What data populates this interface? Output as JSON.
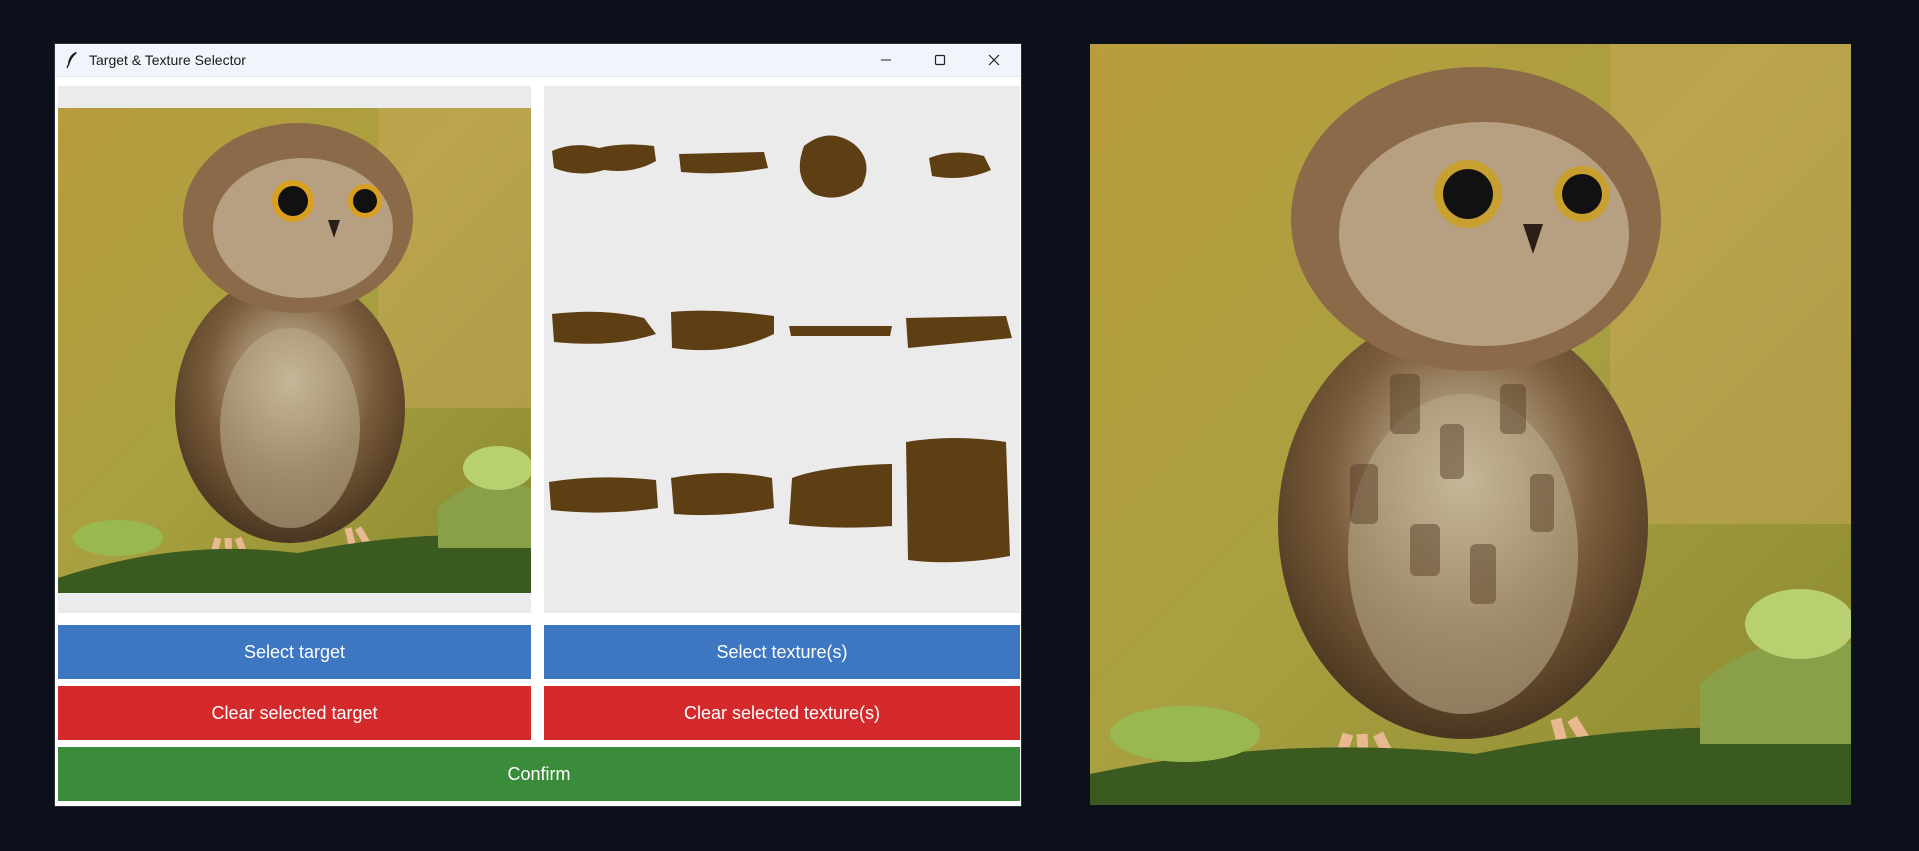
{
  "window": {
    "title": "Target & Texture Selector",
    "icon": "feather-icon",
    "controls": [
      "minimize-icon",
      "maximize-icon",
      "close-icon"
    ]
  },
  "buttons": {
    "select_target": "Select target",
    "select_textures": "Select texture(s)",
    "clear_target": "Clear selected target",
    "clear_textures": "Clear selected texture(s)",
    "confirm": "Confirm"
  },
  "colors": {
    "select": "#3d76c1",
    "clear": "#d42a2b",
    "confirm": "#3a8b3a",
    "texture_brush": "#5e3f14",
    "desktop": "#0c101a"
  },
  "textures": {
    "count": 12
  }
}
